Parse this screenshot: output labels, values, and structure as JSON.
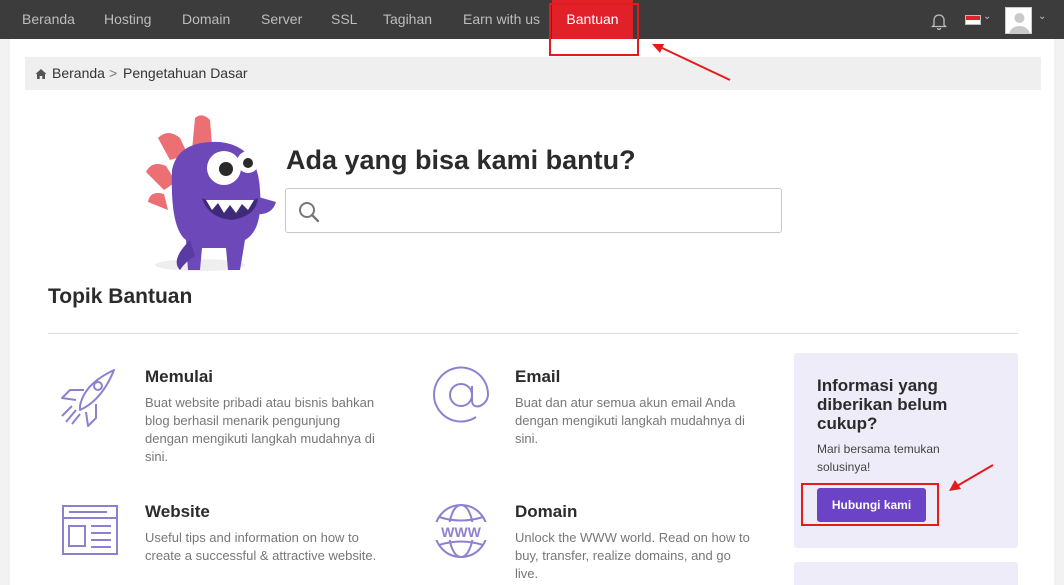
{
  "nav": {
    "items": [
      {
        "label": "Beranda"
      },
      {
        "label": "Hosting"
      },
      {
        "label": "Domain"
      },
      {
        "label": "Server"
      },
      {
        "label": "SSL"
      },
      {
        "label": "Tagihan"
      },
      {
        "label": "Earn with us"
      },
      {
        "label": "Bantuan",
        "active": true
      }
    ],
    "icons": [
      "bell-icon",
      "flag-indonesia-icon",
      "avatar"
    ]
  },
  "breadcrumb": {
    "home": "Beranda",
    "separator": ">",
    "current": "Pengetahuan Dasar"
  },
  "hero": {
    "title": "Ada yang bisa kami bantu?",
    "search_placeholder": ""
  },
  "section": {
    "title": "Topik Bantuan"
  },
  "topics": [
    {
      "icon": "rocket-icon",
      "title": "Memulai",
      "desc": "Buat website pribadi atau bisnis bahkan blog berhasil menarik pengunjung dengan mengikuti langkah mudahnya di sini."
    },
    {
      "icon": "at-sign-icon",
      "title": "Email",
      "desc": "Buat dan atur semua akun email Anda dengan mengikuti langkah mudahnya di sini."
    },
    {
      "icon": "website-layout-icon",
      "title": "Website",
      "desc": "Useful tips and information on how to create a successful & attractive website."
    },
    {
      "icon": "www-globe-icon",
      "title": "Domain",
      "desc": "Unlock the WWW world. Read on how to buy, transfer, realize domains, and go live."
    }
  ],
  "help_card": {
    "title": "Informasi yang diberikan belum cukup?",
    "text": "Mari bersama temukan solusinya!",
    "button": "Hubungi kami"
  },
  "colors": {
    "nav_bg": "#3c3c3c",
    "active": "#e0212a",
    "accent": "#6b43c6",
    "icon": "#8f80cf",
    "card_bg": "#eeecf8"
  }
}
